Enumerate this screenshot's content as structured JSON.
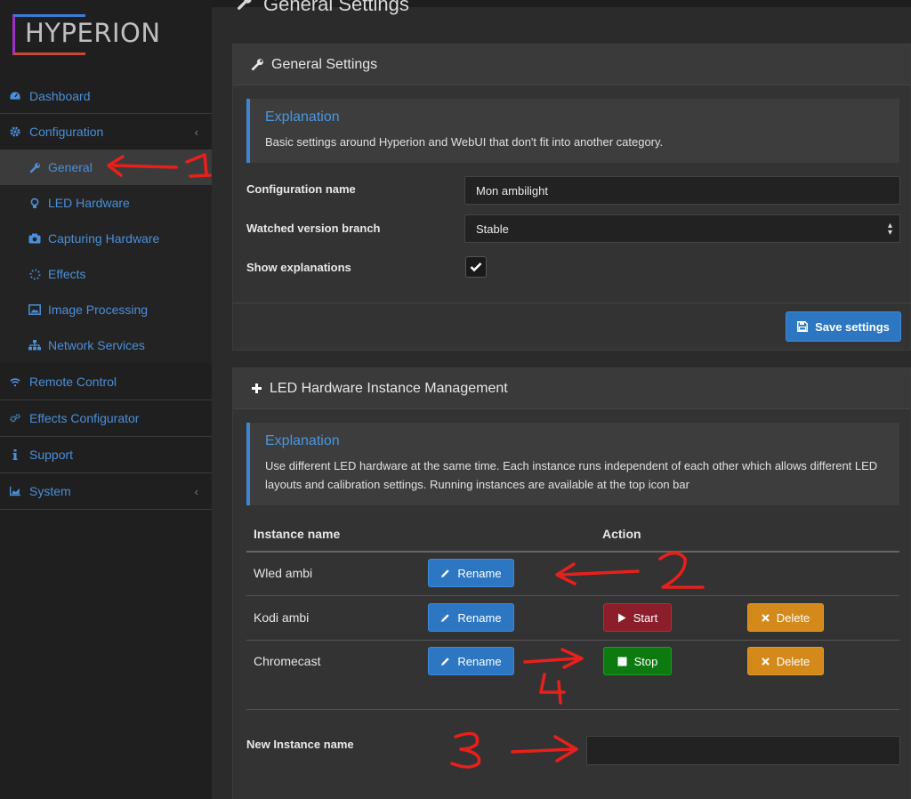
{
  "logo": {
    "text": "HYPERION"
  },
  "sidebar": {
    "items": [
      {
        "label": "Dashboard",
        "icon": "dashboard-icon"
      },
      {
        "label": "Configuration",
        "icon": "gear-icon",
        "caret": "‹"
      },
      {
        "label": "Remote Control",
        "icon": "wifi-icon"
      },
      {
        "label": "Effects Configurator",
        "icon": "gears-icon"
      },
      {
        "label": "Support",
        "icon": "info-icon"
      },
      {
        "label": "System",
        "icon": "chart-icon",
        "caret": "‹"
      }
    ],
    "subitems": [
      {
        "label": "General",
        "icon": "wrench-icon",
        "active": true
      },
      {
        "label": "LED Hardware",
        "icon": "bulb-icon"
      },
      {
        "label": "Capturing Hardware",
        "icon": "camera-icon"
      },
      {
        "label": "Effects",
        "icon": "spinner-icon"
      },
      {
        "label": "Image Processing",
        "icon": "image-icon"
      },
      {
        "label": "Network Services",
        "icon": "sitemap-icon"
      }
    ]
  },
  "page": {
    "title": "General Settings"
  },
  "general_panel": {
    "title": "General Settings",
    "explanation_title": "Explanation",
    "explanation_text": "Basic settings around Hyperion and WebUI that don't fit into another category.",
    "config_name_label": "Configuration name",
    "config_name_value": "Mon ambilight",
    "branch_label": "Watched version branch",
    "branch_value": "Stable",
    "show_expl_label": "Show explanations",
    "show_expl_checked": true,
    "save_label": "Save settings"
  },
  "led_panel": {
    "title": "LED Hardware Instance Management",
    "explanation_title": "Explanation",
    "explanation_text": "Use different LED hardware at the same time. Each instance runs independent of each other which allows different LED layouts and calibration settings. Running instances are available at the top icon bar",
    "col_instance": "Instance name",
    "col_action": "Action",
    "rows": [
      {
        "name": "Wled ambi",
        "rename": "Rename"
      },
      {
        "name": "Kodi ambi",
        "rename": "Rename",
        "toggle": "Start",
        "delete": "Delete"
      },
      {
        "name": "Chromecast",
        "rename": "Rename",
        "toggle": "Stop",
        "delete": "Delete"
      }
    ],
    "new_instance_label": "New Instance name",
    "new_instance_value": ""
  },
  "colors": {
    "accent": "#4a8fd9",
    "annotation": "#e8201c"
  }
}
